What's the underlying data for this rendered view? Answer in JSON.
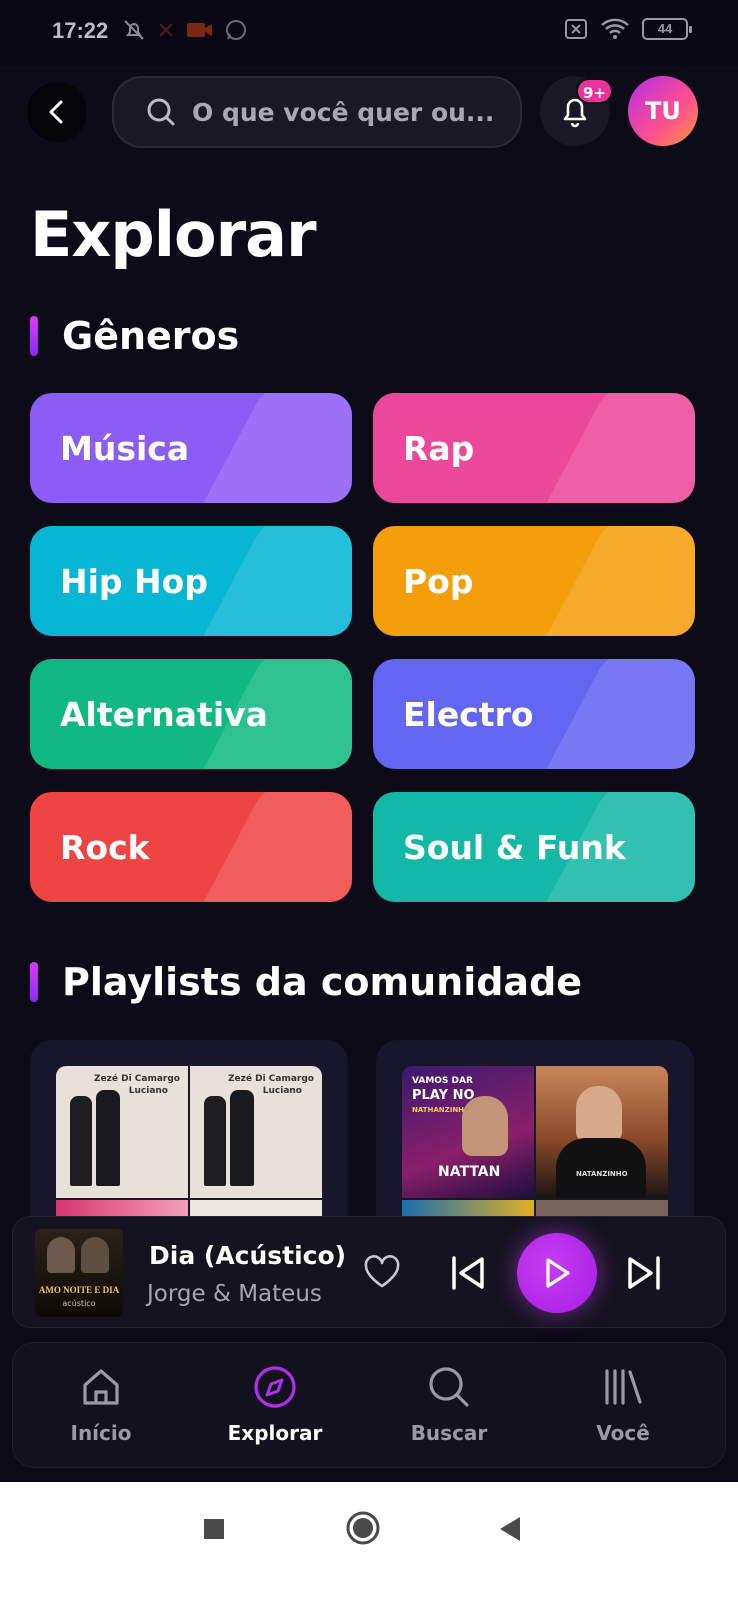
{
  "status_bar": {
    "time": "17:22",
    "battery": "44",
    "icons": [
      "mute-icon",
      "missed-call-icon",
      "video-icon",
      "whatsapp-icon",
      "no-sim-icon",
      "wifi-icon",
      "battery-icon"
    ]
  },
  "header": {
    "search_placeholder": "O que você quer ou...",
    "notification_badge": "9+",
    "avatar_initials": "TU"
  },
  "page": {
    "title": "Explorar"
  },
  "genres": {
    "title": "Gêneros",
    "items": [
      {
        "label": "Música",
        "color": "#8b5cf6"
      },
      {
        "label": "Rap",
        "color": "#ec4899"
      },
      {
        "label": "Hip Hop",
        "color": "#06b6d4"
      },
      {
        "label": "Pop",
        "color": "#f59e0b"
      },
      {
        "label": "Alternativa",
        "color": "#10b981"
      },
      {
        "label": "Electro",
        "color": "#6366f1"
      },
      {
        "label": "Rock",
        "color": "#ef4444"
      },
      {
        "label": "Soul & Funk",
        "color": "#14b8a6"
      }
    ]
  },
  "playlists": {
    "title": "Playlists da comunidade",
    "covers": [
      {
        "labels": [
          "Zezé Di Camargo",
          "Luciano",
          "Zezé Di Camargo",
          "Luciano"
        ]
      },
      {
        "labels": [
          "VAMOS DAR",
          "PLAY NO",
          "NATHANZINHO",
          "NATTAN",
          "NATANZINHO"
        ]
      }
    ]
  },
  "now_playing": {
    "title": "Dia (Acústico)",
    "artist": "Jorge & Mateus",
    "art_text": "AMO NOITE E DIA",
    "art_subtext": "acústico"
  },
  "bottom_nav": {
    "items": [
      {
        "label": "Início",
        "icon": "home-icon",
        "active": false
      },
      {
        "label": "Explorar",
        "icon": "compass-icon",
        "active": true
      },
      {
        "label": "Buscar",
        "icon": "search-icon",
        "active": false
      },
      {
        "label": "Você",
        "icon": "library-icon",
        "active": false
      }
    ]
  },
  "colors": {
    "background": "#0d0b17",
    "accent": "#b12fe8",
    "badge": "#e9339a"
  }
}
